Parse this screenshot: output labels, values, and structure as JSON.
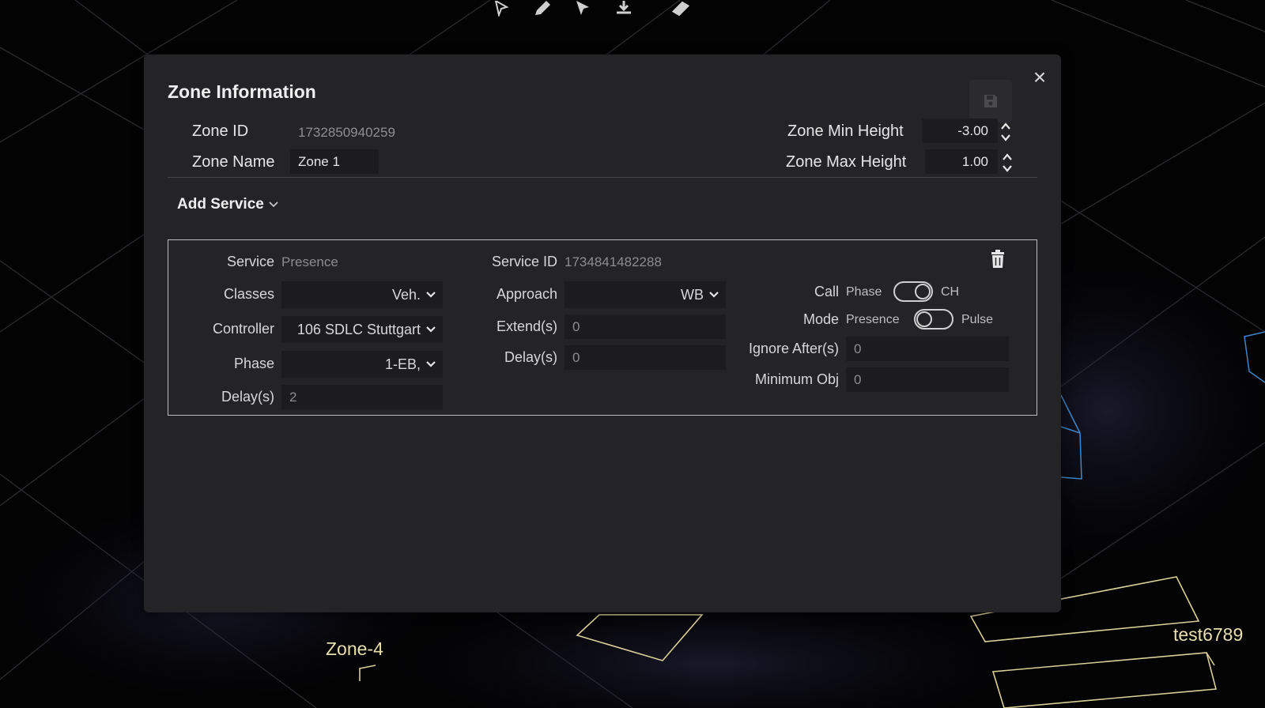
{
  "toolbar": {
    "icons": [
      "cursor-icon",
      "pencil-icon",
      "select-arrow-icon",
      "align-bottom-icon",
      "ruler-icon"
    ]
  },
  "scene": {
    "labels": [
      "Zone-4",
      "test6789"
    ]
  },
  "modal": {
    "title": "Zone Information",
    "close_glyph": "×",
    "zone_id_label": "Zone ID",
    "zone_id_value": "1732850940259",
    "zone_name_label": "Zone Name",
    "zone_name_value": "Zone 1",
    "min_height_label": "Zone Min Height",
    "min_height_value": "-3.00",
    "max_height_label": "Zone Max Height",
    "max_height_value": "1.00",
    "add_service_label": "Add Service"
  },
  "service": {
    "service_label": "Service",
    "service_value": "Presence",
    "service_id_label": "Service ID",
    "service_id_value": "1734841482288",
    "classes_label": "Classes",
    "classes_value": "Veh.",
    "controller_label": "Controller",
    "controller_value": "106 SDLC Stuttgart",
    "phase_label": "Phase",
    "phase_value": "1-EB,",
    "delay_label": "Delay(s)",
    "delay_value": "2",
    "approach_label": "Approach",
    "approach_value": "WB",
    "extend_label": "Extend(s)",
    "extend_value": "0",
    "delay2_label": "Delay(s)",
    "delay2_value": "0",
    "call_label": "Call",
    "call_left": "Phase",
    "call_right": "CH",
    "call_state": "right",
    "mode_label": "Mode",
    "mode_left": "Presence",
    "mode_right": "Pulse",
    "mode_state": "left",
    "ignore_after_label": "Ignore After(s)",
    "ignore_after_value": "0",
    "min_obj_label": "Minimum Obj",
    "min_obj_value": "0"
  },
  "colors": {
    "modal_bg": "#242427",
    "input_bg": "#1c1c1f",
    "zone_outline": "#d9cf98",
    "cube_blue": "#3e86c9"
  }
}
